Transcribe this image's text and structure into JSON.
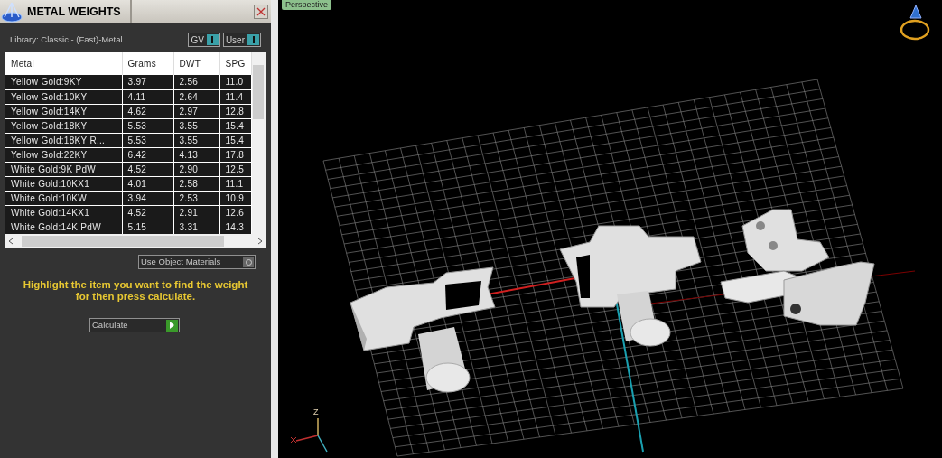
{
  "panel": {
    "title": "METAL WEIGHTS",
    "library": "Library: Classic - (Fast)-Metal",
    "toggles": [
      {
        "label": "GV",
        "on": true
      },
      {
        "label": "User",
        "on": true
      }
    ],
    "table": {
      "columns": [
        "Metal",
        "Grams",
        "DWT",
        "SPG"
      ],
      "rows": [
        [
          "Yellow Gold:9KY",
          "3.97",
          "2.56",
          "11.0"
        ],
        [
          "Yellow Gold:10KY",
          "4.11",
          "2.64",
          "11.4"
        ],
        [
          "Yellow Gold:14KY",
          "4.62",
          "2.97",
          "12.8"
        ],
        [
          "Yellow Gold:18KY",
          "5.53",
          "3.55",
          "15.4"
        ],
        [
          "Yellow Gold:18KY R...",
          "5.53",
          "3.55",
          "15.4"
        ],
        [
          "Yellow Gold:22KY",
          "6.42",
          "4.13",
          "17.8"
        ],
        [
          "White Gold:9K PdW",
          "4.52",
          "2.90",
          "12.5"
        ],
        [
          "White Gold:10KX1",
          "4.01",
          "2.58",
          "11.1"
        ],
        [
          "White Gold:10KW",
          "3.94",
          "2.53",
          "10.9"
        ],
        [
          "White Gold:14KX1",
          "4.52",
          "2.91",
          "12.6"
        ],
        [
          "White Gold:14K PdW",
          "5.15",
          "3.31",
          "14.3"
        ]
      ]
    },
    "use_object_materials": {
      "label": "Use Object Materials",
      "checked": false
    },
    "hint": "Highlight the item you want to find the weight for then press calculate.",
    "calculate_button": "Calculate"
  },
  "viewport": {
    "tab": "Perspective",
    "axis_label": "Z"
  }
}
